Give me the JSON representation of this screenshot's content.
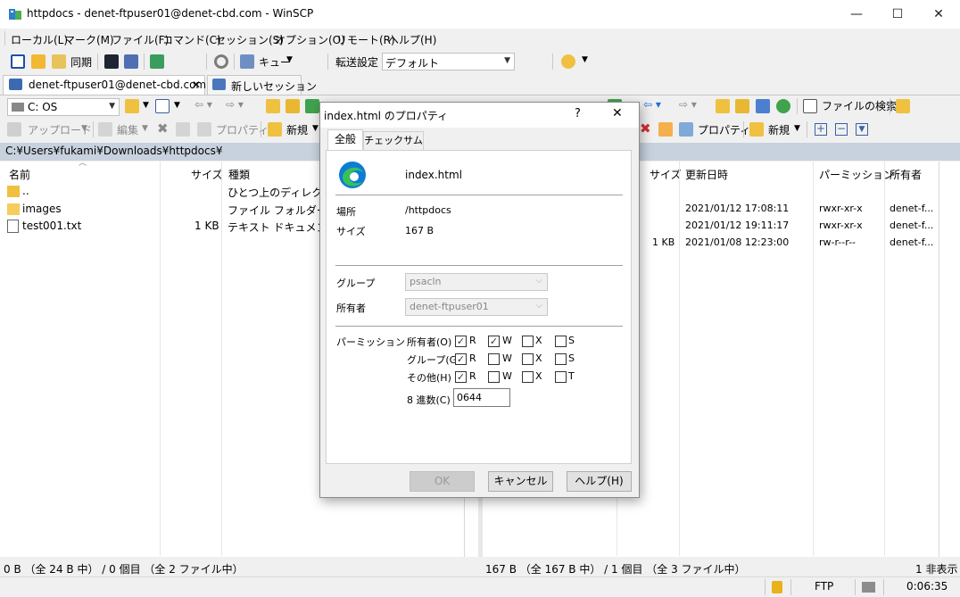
{
  "window": {
    "title": "httpdocs - denet-ftpuser01@denet-cbd.com - WinSCP",
    "minimize": "—",
    "maximize": "☐",
    "close": "✕"
  },
  "menu": [
    "ローカル(L)",
    "マーク(M)",
    "ファイル(F)",
    "コマンド(C)",
    "セッション(S)",
    "オプション(O)",
    "リモート(R)",
    "ヘルプ(H)"
  ],
  "toolbar": {
    "sync_label": "同期",
    "queue_label": "キュー",
    "transfer_settings_label": "転送設定",
    "transfer_settings_value": "デフォルト"
  },
  "tabs": {
    "session_tab": "denet-ftpuser01@denet-cbd.com",
    "session_close": "✕",
    "new_session": "新しいセッション"
  },
  "left_panel": {
    "drive": "C: OS",
    "upload": "アップロード",
    "edit": "編集",
    "properties": "プロパティ",
    "new": "新規",
    "path": "C:¥Users¥fukami¥Downloads¥httpdocs¥",
    "columns": [
      "名前",
      "サイズ",
      "種類"
    ],
    "rows": [
      {
        "name": "..",
        "size": "",
        "type": "ひとつ上のディレクトリ"
      },
      {
        "name": "images",
        "size": "",
        "type": "ファイル フォルダー"
      },
      {
        "name": "test001.txt",
        "size": "1 KB",
        "type": "テキスト ドキュメント"
      }
    ],
    "status": "0 B （全 24 B 中） / 0 個目 （全 2 ファイル中）"
  },
  "right_panel": {
    "find_files": "ファイルの検索",
    "properties": "プロパティ",
    "new": "新規",
    "columns": [
      "サイズ",
      "更新日時",
      "パーミッション",
      "所有者"
    ],
    "rows": [
      {
        "size": "",
        "modified": "2021/01/12 17:08:11",
        "perm": "rwxr-xr-x",
        "owner": "denet-f..."
      },
      {
        "size": "",
        "modified": "2021/01/12 19:11:17",
        "perm": "rwxr-xr-x",
        "owner": "denet-f..."
      },
      {
        "size": "1 KB",
        "modified": "2021/01/08 12:23:00",
        "perm": "rw-r--r--",
        "owner": "denet-f..."
      }
    ],
    "status": "167 B （全 167 B 中） / 1 個目 （全 3 ファイル中）",
    "hidden": "1 非表示"
  },
  "statusbar": {
    "protocol": "FTP",
    "time": "0:06:35"
  },
  "dialog": {
    "title": "index.html のプロパティ",
    "help": "?",
    "close": "✕",
    "tab_general": "全般",
    "tab_checksum": "チェックサム",
    "filename": "index.html",
    "location_label": "場所",
    "location_value": "/httpdocs",
    "size_label": "サイズ",
    "size_value": "167 B",
    "group_label": "グループ",
    "group_value": "psacln",
    "owner_label": "所有者",
    "owner_value": "denet-ftpuser01",
    "perm_label": "パーミッション",
    "perm_rows": [
      {
        "label": "所有者(O)",
        "r": true,
        "w": true,
        "x": false,
        "s": false,
        "last": "S"
      },
      {
        "label": "グループ(G)",
        "r": true,
        "w": false,
        "x": false,
        "s": false,
        "last": "S"
      },
      {
        "label": "その他(H)",
        "r": true,
        "w": false,
        "x": false,
        "s": false,
        "last": "T"
      }
    ],
    "r": "R",
    "w": "W",
    "x": "X",
    "octal_label": "8 進数(C)",
    "octal_value": "0644",
    "ok": "OK",
    "cancel": "キャンセル",
    "help_button": "ヘルプ(H)"
  },
  "colors": {
    "path_bar": "#c7d2de",
    "edge_blue": "#0c7cd5",
    "edge_green": "#36c15c"
  }
}
